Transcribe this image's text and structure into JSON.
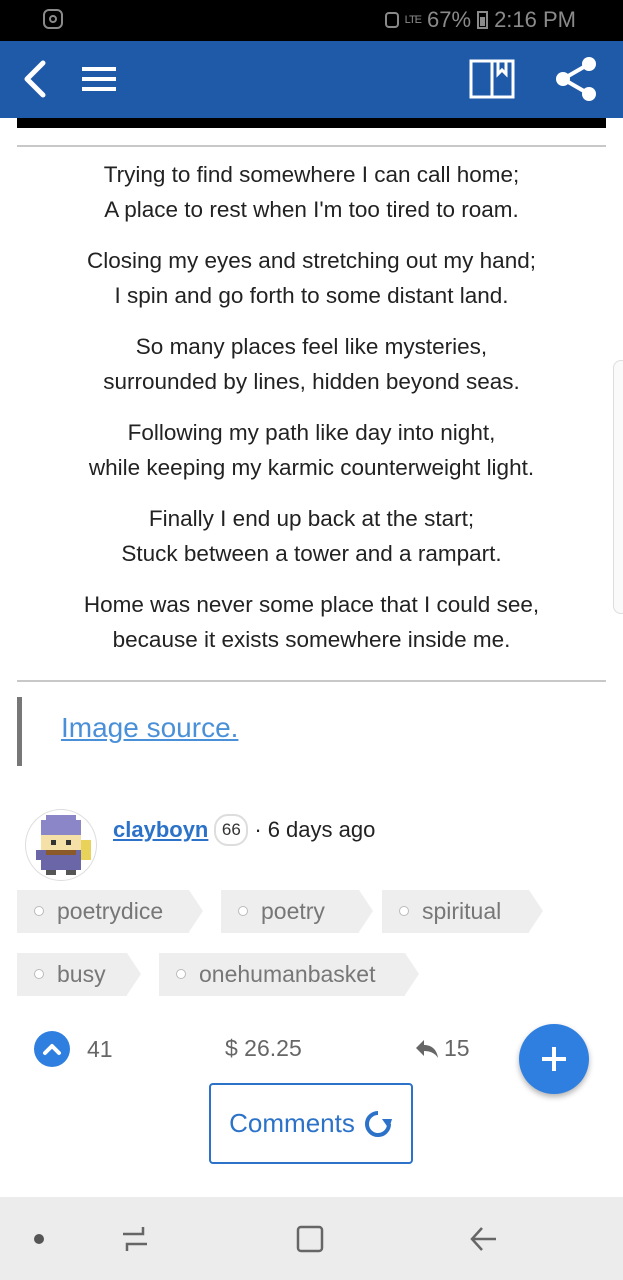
{
  "status_bar": {
    "battery": "67%",
    "time": "2:16 PM",
    "network": "LTE"
  },
  "app_bar": {
    "icons": [
      "back-arrow-icon",
      "hamburger-menu-icon",
      "book-bookmark-icon",
      "share-icon"
    ],
    "color": "#1f5aa9"
  },
  "poem": {
    "stanzas": [
      [
        "Trying to find somewhere I can call home;",
        "A place to rest when I'm too tired to roam."
      ],
      [
        "Closing my eyes and stretching out my hand;",
        "I spin and go forth to some distant land."
      ],
      [
        "So many places feel like mysteries,",
        "surrounded by lines, hidden beyond seas."
      ],
      [
        "Following my path like day into night,",
        "while keeping my karmic counterweight light."
      ],
      [
        "Finally I end up back at the start;",
        "Stuck between a tower and a rampart."
      ],
      [
        "Home was never some place that I could see,",
        "because it exists somewhere inside me."
      ]
    ]
  },
  "source": {
    "link_text": "Image source."
  },
  "author": {
    "name": "clayboyn",
    "reputation": "66",
    "separator": "·",
    "age": "6 days ago"
  },
  "tags": [
    "poetrydice",
    "poetry",
    "spiritual",
    "busy",
    "onehumanbasket"
  ],
  "stats": {
    "votes": "41",
    "payout": "$ 26.25",
    "replies": "15"
  },
  "comments_button": {
    "label": "Comments"
  },
  "accent": "#2f7fe0"
}
